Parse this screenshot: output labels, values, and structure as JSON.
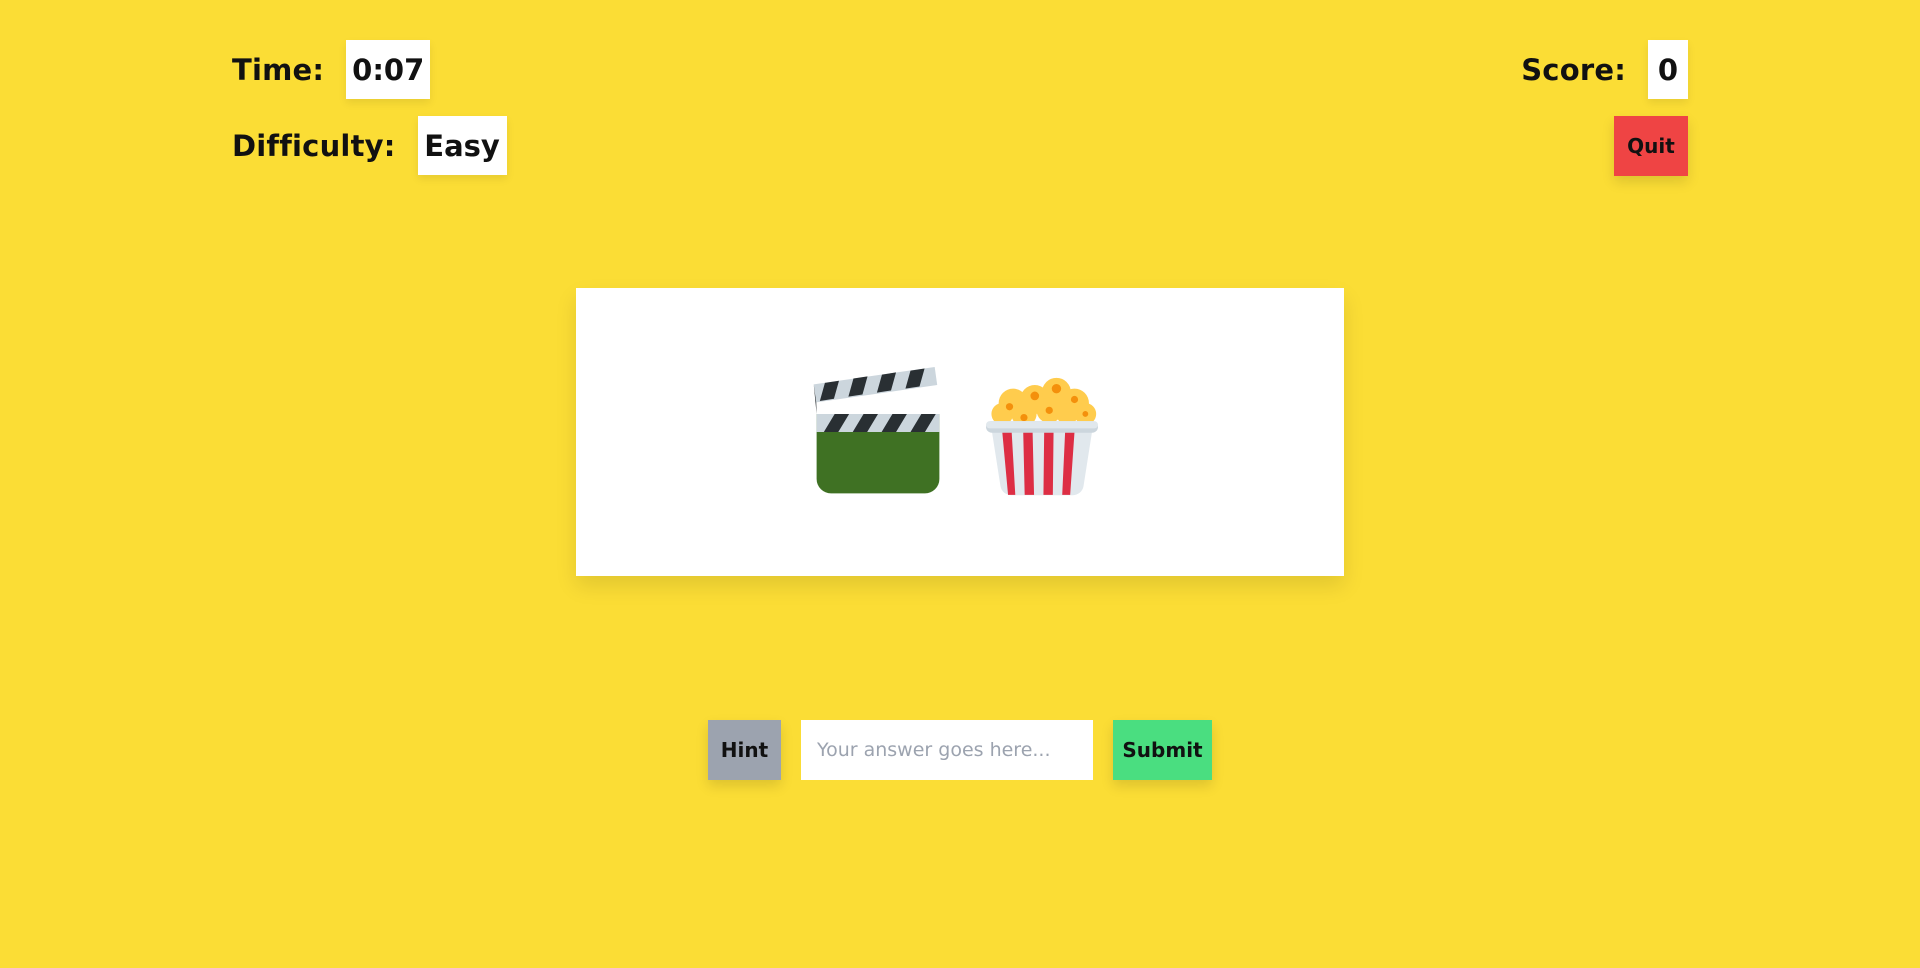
{
  "stats": {
    "time_label": "Time:",
    "time_value": "0:07",
    "difficulty_label": "Difficulty:",
    "difficulty_value": "Easy",
    "score_label": "Score:",
    "score_value": "0"
  },
  "controls": {
    "quit_label": "Quit",
    "hint_label": "Hint",
    "submit_label": "Submit",
    "answer_placeholder": "Your answer goes here...",
    "answer_value": ""
  },
  "puzzle": {
    "emojis": [
      "clapper-board-icon",
      "popcorn-icon"
    ]
  },
  "colors": {
    "background": "#fbdd35",
    "quit": "#ef4444",
    "hint": "#9ca3af",
    "submit": "#4ade80",
    "card": "#ffffff"
  }
}
